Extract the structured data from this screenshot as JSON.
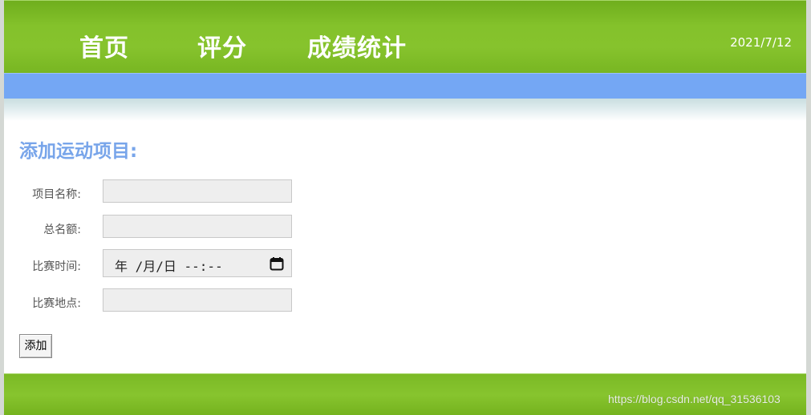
{
  "nav": {
    "items": [
      {
        "label": "首页"
      },
      {
        "label": "评分"
      },
      {
        "label": "成绩统计"
      }
    ],
    "date": "2021/7/12"
  },
  "main": {
    "title": "添加运动项目:",
    "form": {
      "fields": [
        {
          "label": "项目名称:",
          "value": ""
        },
        {
          "label": "总名额:",
          "value": ""
        },
        {
          "label": "比赛时间:",
          "display": "年 /月/日 --:--",
          "icon": "calendar-icon"
        },
        {
          "label": "比赛地点:",
          "value": ""
        }
      ],
      "submit_label": "添加"
    }
  },
  "footer": {
    "watermark": "https://blog.csdn.net/qq_31536103"
  },
  "colors": {
    "header_green": "#84c22b",
    "accent_blue": "#74a7f4",
    "title_blue": "#78a5ea"
  }
}
